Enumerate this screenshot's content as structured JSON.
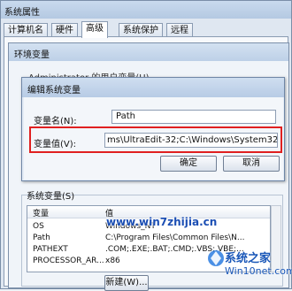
{
  "outer": {
    "title": "系统属性",
    "tabs": [
      {
        "label": "计算机名"
      },
      {
        "label": "硬件"
      },
      {
        "label": "高级"
      },
      {
        "label": "系统保护"
      },
      {
        "label": "远程"
      }
    ]
  },
  "env": {
    "title": "环境变量",
    "user_vars_label": "Administrator 的用户变量(U)"
  },
  "edit_dialog": {
    "title": "编辑系统变量",
    "name_label": "变量名(N):",
    "name_value": "Path",
    "value_label": "变量值(V):",
    "value_value": "ms\\UltraEdit-32;C:\\Windows\\System32",
    "ok": "确定",
    "cancel": "取消"
  },
  "system_vars": {
    "label": "系统变量(S)",
    "columns": [
      "变量",
      "值"
    ],
    "rows": [
      {
        "name": "OS",
        "value": "Windows_NT"
      },
      {
        "name": "Path",
        "value": "C:\\Program Files\\Common Files\\N..."
      },
      {
        "name": "PATHEXT",
        "value": ".COM;.EXE;.BAT;.CMD;.VBS;.VBE;..."
      },
      {
        "name": "PROCESSOR_AR...",
        "value": "x86"
      }
    ],
    "new_button": "新建(W)..."
  },
  "watermark": {
    "site": "www.win7zhijia.cn",
    "brand": "系统之家",
    "domain": "Win10net.com"
  },
  "colors": {
    "highlight_box": "#e02020",
    "watermark_blue": "#1a57b8"
  }
}
